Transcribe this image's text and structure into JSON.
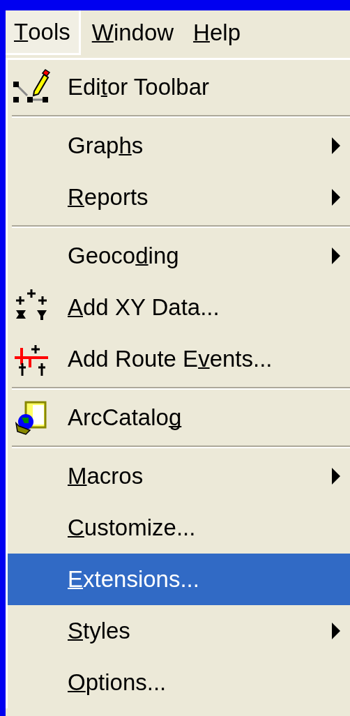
{
  "menu_bar": [
    {
      "label": [
        {
          "text": "T",
          "underline": true
        },
        {
          "text": "ools",
          "underline": false
        }
      ],
      "selected": true
    },
    {
      "label": [
        {
          "text": "W",
          "underline": true
        },
        {
          "text": "indow",
          "underline": false
        }
      ],
      "selected": false
    },
    {
      "label": [
        {
          "text": "H",
          "underline": true
        },
        {
          "text": "elp",
          "underline": false
        }
      ],
      "selected": false
    }
  ],
  "menu": [
    {
      "kind": "item",
      "label": [
        {
          "text": "Edi",
          "underline": false
        },
        {
          "text": "t",
          "underline": true
        },
        {
          "text": "or Toolbar",
          "underline": false
        }
      ],
      "submenu": false,
      "selected": false
    },
    {
      "kind": "separator"
    },
    {
      "kind": "item",
      "label": [
        {
          "text": "Grap",
          "underline": false
        },
        {
          "text": "h",
          "underline": true
        },
        {
          "text": "s",
          "underline": false
        }
      ],
      "submenu": true,
      "selected": false
    },
    {
      "kind": "item",
      "label": [
        {
          "text": "R",
          "underline": true
        },
        {
          "text": "eports",
          "underline": false
        }
      ],
      "submenu": true,
      "selected": false
    },
    {
      "kind": "separator"
    },
    {
      "kind": "item",
      "label": [
        {
          "text": "Geoco",
          "underline": false
        },
        {
          "text": "d",
          "underline": true
        },
        {
          "text": "ing",
          "underline": false
        }
      ],
      "submenu": true,
      "selected": false
    },
    {
      "kind": "item",
      "label": [
        {
          "text": "A",
          "underline": true
        },
        {
          "text": "dd XY Data...",
          "underline": false
        }
      ],
      "submenu": false,
      "selected": false
    },
    {
      "kind": "item",
      "label": [
        {
          "text": "Add Route E",
          "underline": false
        },
        {
          "text": "v",
          "underline": true
        },
        {
          "text": "ents...",
          "underline": false
        }
      ],
      "submenu": false,
      "selected": false
    },
    {
      "kind": "separator"
    },
    {
      "kind": "item",
      "label": [
        {
          "text": "ArcCatalo",
          "underline": false
        },
        {
          "text": "g",
          "underline": true
        }
      ],
      "submenu": false,
      "selected": false
    },
    {
      "kind": "separator"
    },
    {
      "kind": "item",
      "label": [
        {
          "text": "M",
          "underline": true
        },
        {
          "text": "acros",
          "underline": false
        }
      ],
      "submenu": true,
      "selected": false
    },
    {
      "kind": "item",
      "label": [
        {
          "text": "C",
          "underline": true
        },
        {
          "text": "ustomize...",
          "underline": false
        }
      ],
      "submenu": false,
      "selected": false
    },
    {
      "kind": "item",
      "label": [
        {
          "text": "E",
          "underline": true
        },
        {
          "text": "xtensions...",
          "underline": false
        }
      ],
      "submenu": false,
      "selected": true
    },
    {
      "kind": "item",
      "label": [
        {
          "text": "S",
          "underline": true
        },
        {
          "text": "tyles",
          "underline": false
        }
      ],
      "submenu": true,
      "selected": false
    },
    {
      "kind": "item",
      "label": [
        {
          "text": "O",
          "underline": true
        },
        {
          "text": "ptions...",
          "underline": false
        }
      ],
      "submenu": false,
      "selected": false
    }
  ]
}
